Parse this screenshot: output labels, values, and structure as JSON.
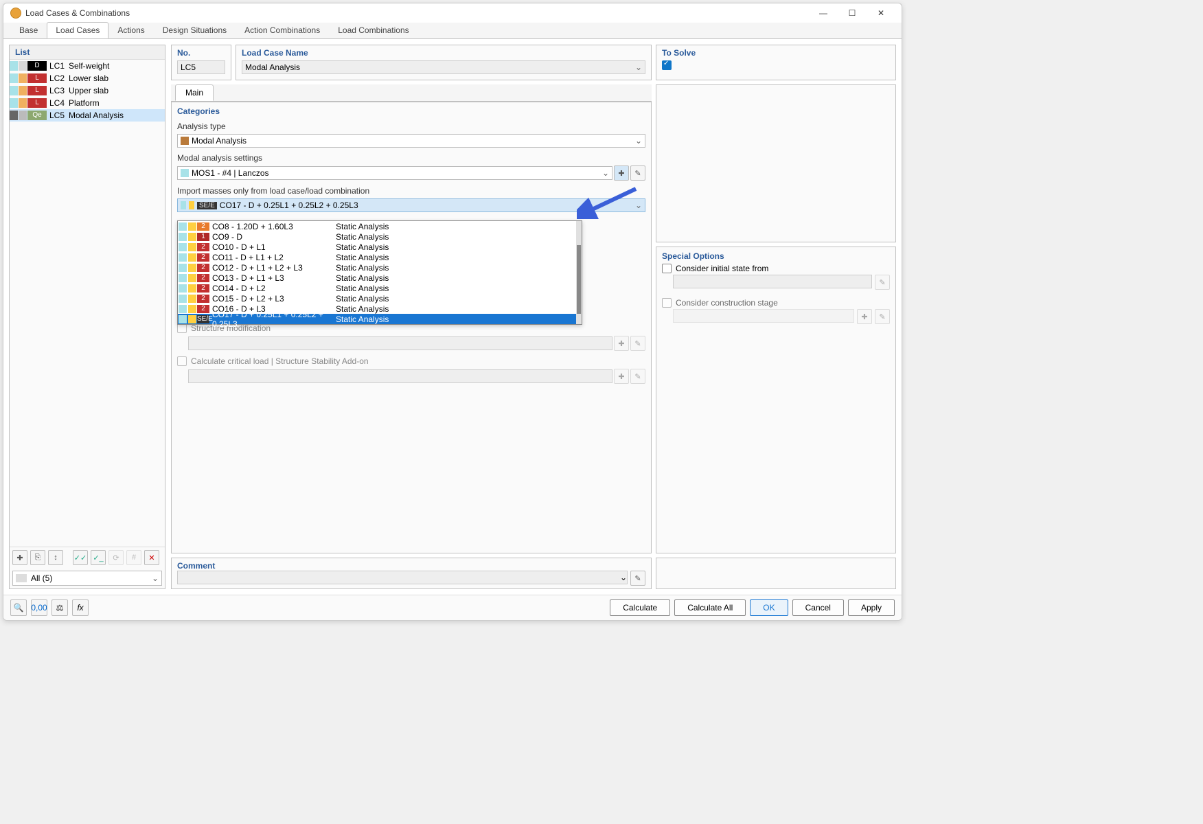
{
  "window": {
    "title": "Load Cases & Combinations"
  },
  "tabs": [
    "Base",
    "Load Cases",
    "Actions",
    "Design Situations",
    "Action Combinations",
    "Load Combinations"
  ],
  "active_tab": 1,
  "list": {
    "header": "List",
    "items": [
      {
        "chip1": "#a8e2e8",
        "chip2": "#d8d8d8",
        "cat_bg": "#000",
        "cat": "D",
        "id": "LC1",
        "name": "Self-weight"
      },
      {
        "chip1": "#a8e2e8",
        "chip2": "#f0b060",
        "cat_bg": "#c23030",
        "cat": "L",
        "id": "LC2",
        "name": "Lower slab"
      },
      {
        "chip1": "#a8e2e8",
        "chip2": "#f0b060",
        "cat_bg": "#c23030",
        "cat": "L",
        "id": "LC3",
        "name": "Upper slab"
      },
      {
        "chip1": "#a8e2e8",
        "chip2": "#f0b060",
        "cat_bg": "#c23030",
        "cat": "L",
        "id": "LC4",
        "name": "Platform"
      },
      {
        "chip1": "#666",
        "chip2": "#bbb",
        "cat_bg": "#8da870",
        "cat": "Qe",
        "id": "LC5",
        "name": "Modal Analysis",
        "selected": true
      }
    ],
    "filter": "All (5)"
  },
  "no": {
    "label": "No.",
    "value": "LC5"
  },
  "name": {
    "label": "Load Case Name",
    "value": "Modal Analysis"
  },
  "solve": {
    "label": "To Solve"
  },
  "subtab": "Main",
  "categories": {
    "title": "Categories",
    "analysis_type_label": "Analysis type",
    "analysis_type_value": "Modal Analysis",
    "analysis_type_swatch": "#b97a3a",
    "modal_settings_label": "Modal analysis settings",
    "modal_settings_value": "MOS1 - #4 | Lanczos",
    "modal_swatch": "#a8e2e8",
    "import_label": "Import masses only from load case/load combination",
    "import_value": "CO17 - D + 0.25L1 + 0.25L2 + 0.25L3",
    "import_swatch1": "#a8e2e8",
    "import_swatch2": "#ffd040",
    "import_cat": "SE/E",
    "import_cat_bg": "#333"
  },
  "dropdown_items": [
    {
      "sw1": "#a8e2e8",
      "sw2": "#ffd040",
      "cat_bg": "#e87b2a",
      "cat": "2",
      "name": "CO8 - 1.20D + 1.60L3",
      "type": "Static Analysis"
    },
    {
      "sw1": "#a8e2e8",
      "sw2": "#ffd040",
      "cat_bg": "#b02828",
      "cat": "1",
      "name": "CO9 - D",
      "type": "Static Analysis"
    },
    {
      "sw1": "#a8e2e8",
      "sw2": "#ffd040",
      "cat_bg": "#c23030",
      "cat": "2",
      "name": "CO10 - D + L1",
      "type": "Static Analysis"
    },
    {
      "sw1": "#a8e2e8",
      "sw2": "#ffd040",
      "cat_bg": "#c23030",
      "cat": "2",
      "name": "CO11 - D + L1 + L2",
      "type": "Static Analysis"
    },
    {
      "sw1": "#a8e2e8",
      "sw2": "#ffd040",
      "cat_bg": "#c23030",
      "cat": "2",
      "name": "CO12 - D + L1 + L2 + L3",
      "type": "Static Analysis"
    },
    {
      "sw1": "#a8e2e8",
      "sw2": "#ffd040",
      "cat_bg": "#c23030",
      "cat": "2",
      "name": "CO13 - D + L1 + L3",
      "type": "Static Analysis"
    },
    {
      "sw1": "#a8e2e8",
      "sw2": "#ffd040",
      "cat_bg": "#c23030",
      "cat": "2",
      "name": "CO14 - D + L2",
      "type": "Static Analysis"
    },
    {
      "sw1": "#a8e2e8",
      "sw2": "#ffd040",
      "cat_bg": "#c23030",
      "cat": "2",
      "name": "CO15 - D + L2 + L3",
      "type": "Static Analysis"
    },
    {
      "sw1": "#a8e2e8",
      "sw2": "#ffd040",
      "cat_bg": "#c23030",
      "cat": "2",
      "name": "CO16 - D + L3",
      "type": "Static Analysis"
    },
    {
      "sw1": "#a8e2e8",
      "sw2": "#ffd040",
      "cat_bg": "#333",
      "cat": "SE/E",
      "name": "CO17 - D + 0.25L1 + 0.25L2 + 0.25L3",
      "type": "Static Analysis",
      "selected": true
    }
  ],
  "checks": {
    "structure_mod": "Structure modification",
    "critical_load": "Calculate critical load | Structure Stability Add-on"
  },
  "special": {
    "title": "Special Options",
    "initial_state": "Consider initial state from",
    "construction_stage": "Consider construction stage"
  },
  "comment": {
    "label": "Comment"
  },
  "buttons": {
    "calculate": "Calculate",
    "calculate_all": "Calculate All",
    "ok": "OK",
    "cancel": "Cancel",
    "apply": "Apply"
  }
}
